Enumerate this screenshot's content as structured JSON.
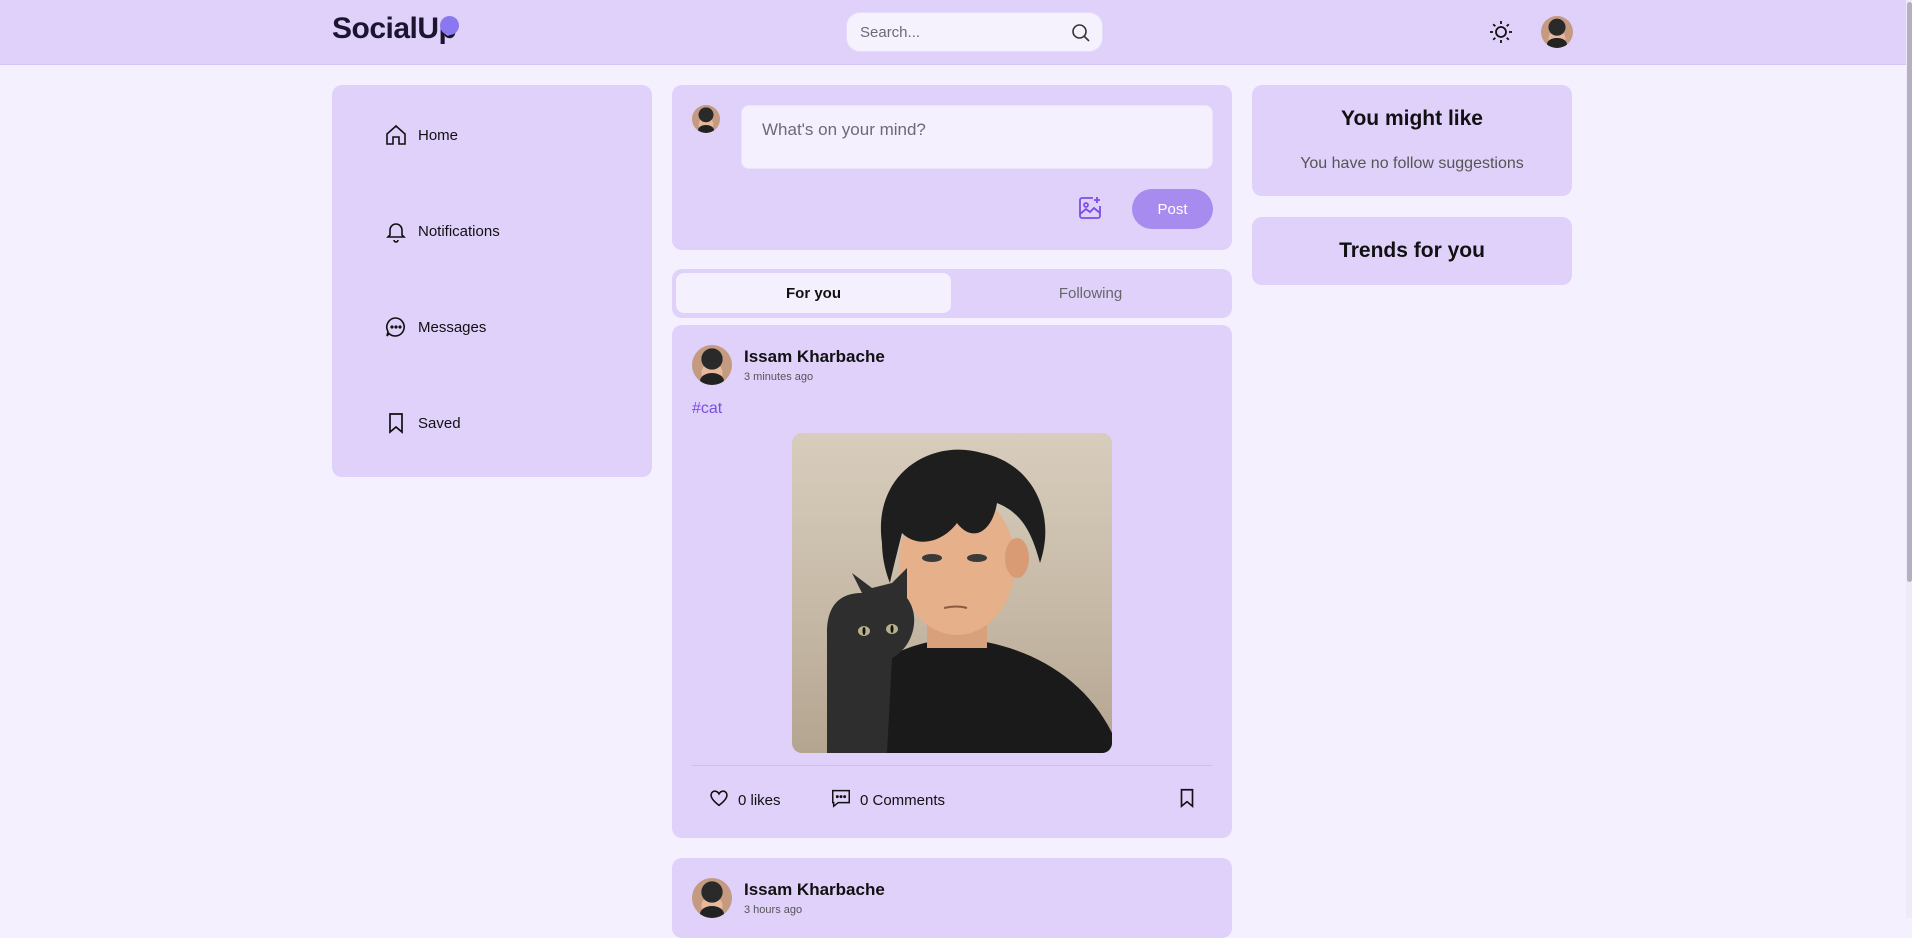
{
  "header": {
    "logo": "SocialUp",
    "search_placeholder": "Search...",
    "icons": {
      "search": "search-icon",
      "theme": "sun-moon-icon",
      "avatar": "avatar"
    }
  },
  "sidebar": {
    "items": [
      {
        "label": "Home",
        "icon": "home-icon"
      },
      {
        "label": "Notifications",
        "icon": "bell-icon"
      },
      {
        "label": "Messages",
        "icon": "chat-icon"
      },
      {
        "label": "Saved",
        "icon": "bookmark-icon"
      }
    ]
  },
  "composer": {
    "placeholder": "What's on your mind?",
    "post_label": "Post",
    "image_icon": "add-image-icon"
  },
  "feed_tabs": [
    {
      "label": "For you",
      "active": true
    },
    {
      "label": "Following",
      "active": false
    }
  ],
  "posts": [
    {
      "author": "Issam Kharbache",
      "time": "3 minutes ago",
      "hashtag": "#cat",
      "likes": "0 likes",
      "comments": "0 Comments"
    },
    {
      "author": "Issam Kharbache",
      "time": "3 hours ago"
    }
  ],
  "right": {
    "suggest_title": "You might like",
    "suggest_empty": "You have no follow suggestions",
    "trends_title": "Trends for you"
  },
  "colors": {
    "header_bg": "#e0d1fb",
    "card_bg": "#e0d1fb",
    "page_bg": "#f4f0fe",
    "accent": "#a78bee",
    "hashtag": "#7c4ee4"
  }
}
